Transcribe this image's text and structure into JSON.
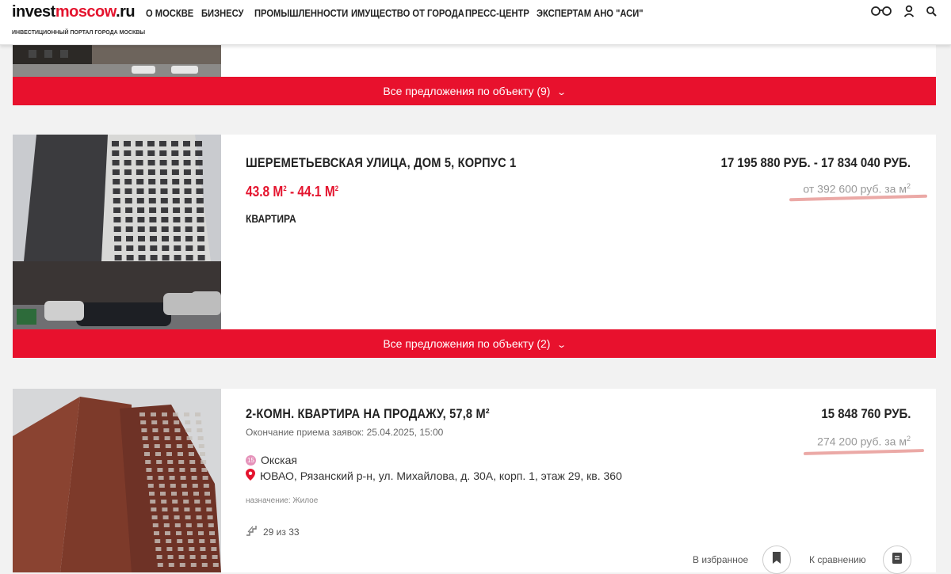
{
  "header": {
    "logo_a": "invest",
    "logo_b": "moscow",
    "logo_c": ".ru",
    "tagline": "ИНВЕСТИЦИОННЫЙ ПОРТАЛ ГОРОДА МОСКВЫ",
    "nav": [
      "О МОСКВЕ",
      "БИЗНЕСУ",
      "ПРОМЫШЛЕННОСТИ",
      "ИМУЩЕСТВО ОТ ГОРОДА",
      "ПРЕСС-ЦЕНТР",
      "ЭКСПЕРТАМ АНО \"АСИ\""
    ],
    "icons": [
      "glasses-icon",
      "user-icon",
      "search-icon"
    ]
  },
  "listing1": {
    "bar_label": "Все предложения по объекту (9)"
  },
  "listing2": {
    "title": "ШЕРЕМЕТЬЕВСКАЯ УЛИЦА, ДОМ 5, КОРПУС 1",
    "area_from": "43.8 М",
    "area_to": "44.1 М",
    "area_sep": " - ",
    "area_sup": "2",
    "type": "КВАРТИРА",
    "price": "17 195 880 РУБ. - 17 834 040 РУБ.",
    "per_m2": "от 392 600 руб. за м",
    "per_sup": "2",
    "bar_label": "Все предложения по объекту (2)"
  },
  "listing3": {
    "title": "2-КОМН. КВАРТИРА НА ПРОДАЖУ, 57,8 М²",
    "deadline": "Окончание приема заявок: 25.04.2025, 15:00",
    "metro_line": "15",
    "metro": "Окская",
    "address": "ЮВАО, Рязанский р-н, ул. Михайлова, д. 30А, корп. 1, этаж 29, кв. 360",
    "purpose": "назначение: Жилое",
    "floor": "29 из 33",
    "price": "15 848 760 РУБ.",
    "per_m2": "274 200 руб. за м",
    "per_sup": "2",
    "favorite_label": "В избранное",
    "compare_label": "К сравнению"
  },
  "colors": {
    "accent": "#e8112d",
    "highlight": "#e89a96"
  }
}
